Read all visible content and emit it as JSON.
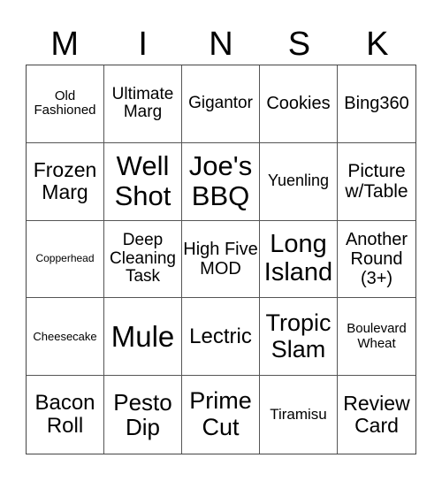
{
  "header": {
    "letters": [
      "M",
      "I",
      "N",
      "S",
      "K"
    ]
  },
  "cells": [
    "Old Fashioned",
    "Ultimate Marg",
    "Gigantor",
    "Cookies",
    "Bing360",
    "Frozen Marg",
    "Well Shot",
    "Joe's BBQ",
    "Yuenling",
    "Picture w/Table",
    "Copperhead",
    "Deep Cleaning Task",
    "High Five MOD",
    "Long Island",
    "Another Round (3+)",
    "Cheesecake",
    "Mule",
    "Lectric",
    "Tropic Slam",
    "Boulevard Wheat",
    "Bacon Roll",
    "Pesto Dip",
    "Prime Cut",
    "Tiramisu",
    "Review Card"
  ]
}
